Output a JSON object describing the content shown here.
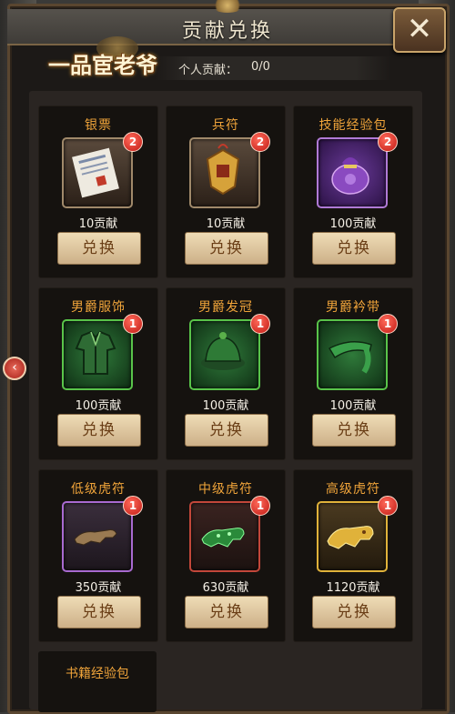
{
  "dialog": {
    "title": "贡献兑换",
    "close_symbol": "✕"
  },
  "logo": {
    "text": "一品宦老爷"
  },
  "contribution": {
    "label": "个人贡献：",
    "value": "0/0"
  },
  "items": [
    {
      "name": "银票",
      "badge": "2",
      "cost": "10贡献",
      "button": "兑换",
      "icon": "banknote-icon",
      "frame": "brown"
    },
    {
      "name": "兵符",
      "badge": "2",
      "cost": "10贡献",
      "button": "兑换",
      "icon": "military-token-icon",
      "frame": "brown"
    },
    {
      "name": "技能经验包",
      "badge": "2",
      "cost": "100贡献",
      "button": "兑换",
      "icon": "skill-bag-icon",
      "frame": "purple"
    },
    {
      "name": "男爵服饰",
      "badge": "1",
      "cost": "100贡献",
      "button": "兑换",
      "icon": "robe-icon",
      "frame": "green"
    },
    {
      "name": "男爵发冠",
      "badge": "1",
      "cost": "100贡献",
      "button": "兑换",
      "icon": "hat-icon",
      "frame": "green"
    },
    {
      "name": "男爵衿带",
      "badge": "1",
      "cost": "100贡献",
      "button": "兑换",
      "icon": "sash-icon",
      "frame": "green"
    },
    {
      "name": "低级虎符",
      "badge": "1",
      "cost": "350贡献",
      "button": "兑换",
      "icon": "bronze-tiger-tally-icon",
      "frame": "violet"
    },
    {
      "name": "中级虎符",
      "badge": "1",
      "cost": "630贡献",
      "button": "兑换",
      "icon": "jade-tiger-tally-icon",
      "frame": "red"
    },
    {
      "name": "高级虎符",
      "badge": "1",
      "cost": "1120贡献",
      "button": "兑换",
      "icon": "gold-tiger-tally-icon",
      "frame": "gold"
    }
  ],
  "partial_item": {
    "name": "书籍经验包"
  },
  "side_arrow": "‹",
  "colors": {
    "accent_orange": "#f0a43a",
    "badge_red": "#c11a14",
    "button_bg": "#e2c89e",
    "button_text": "#6a3e16"
  }
}
